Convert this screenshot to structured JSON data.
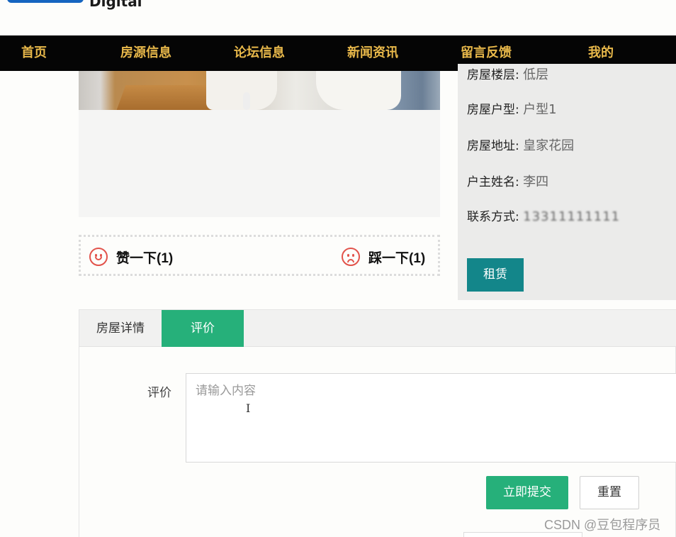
{
  "logo": {
    "text": "Digital"
  },
  "nav": {
    "items": [
      "首页",
      "房源信息",
      "论坛信息",
      "新闻资讯",
      "留言反馈",
      "我的"
    ]
  },
  "votes": {
    "like_label": "赞一下(1)",
    "dislike_label": "踩一下(1)"
  },
  "house_info": {
    "floor_label": "房屋楼层:",
    "floor_value": "低层",
    "type_label": "房屋户型:",
    "type_value": "户型1",
    "address_label": "房屋地址:",
    "address_value": "皇家花园",
    "owner_label": "户主姓名:",
    "owner_value": "李四",
    "contact_label": "联系方式:",
    "contact_value": "13311111111",
    "rent_button": "租赁"
  },
  "tabs": {
    "items": [
      "房屋详情",
      "评价"
    ],
    "active": "评价"
  },
  "comment_form": {
    "label": "评价",
    "placeholder": "请输入内容",
    "submit_label": "立即提交",
    "reset_label": "重置"
  },
  "watermark": "CSDN @豆包程序员",
  "colors": {
    "nav_bg": "#050505",
    "nav_text": "#e8b84a",
    "accent_green": "#26b07a",
    "rent_teal": "#13868a",
    "vote_red": "#e2534b"
  }
}
